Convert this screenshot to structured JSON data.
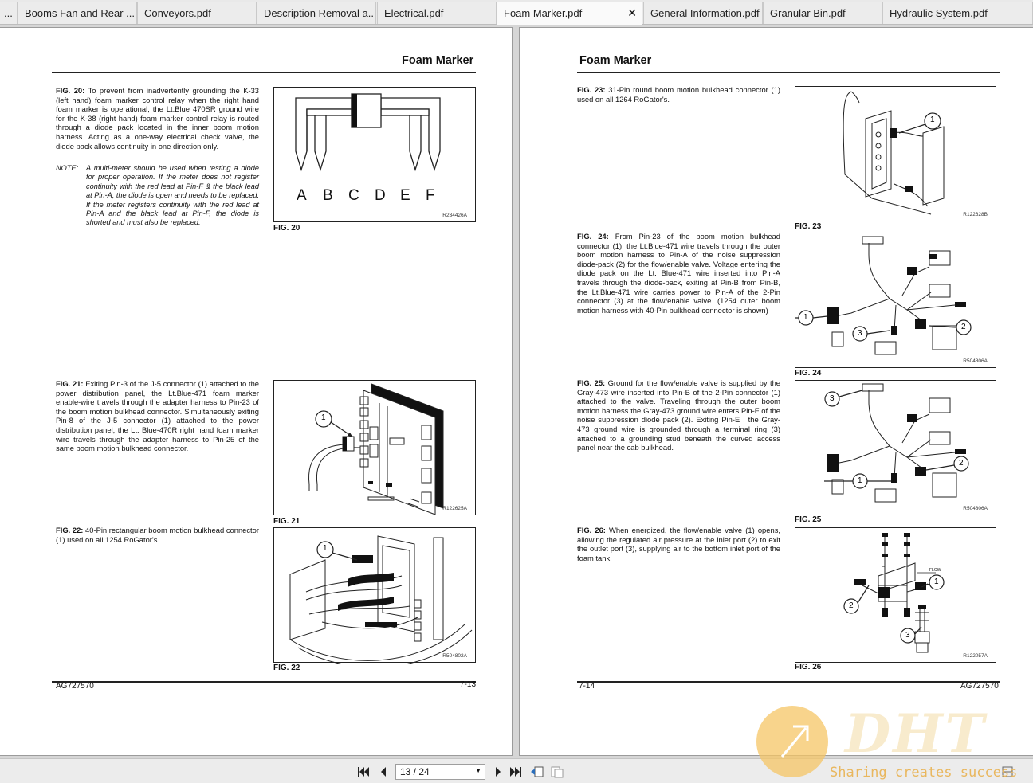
{
  "tabs": [
    {
      "label": "...",
      "active": false
    },
    {
      "label": "Booms Fan and Rear ...",
      "active": false
    },
    {
      "label": "Conveyors.pdf",
      "active": false
    },
    {
      "label": "Description Removal a...",
      "active": false
    },
    {
      "label": "Electrical.pdf",
      "active": false
    },
    {
      "label": "Foam Marker.pdf",
      "active": true,
      "close": "✕"
    },
    {
      "label": "General Information.pdf",
      "active": false
    },
    {
      "label": "Granular Bin.pdf",
      "active": false
    },
    {
      "label": "Hydraulic System.pdf",
      "active": false
    }
  ],
  "left_page": {
    "title": "Foam Marker",
    "fig20": {
      "label": "FIG. 20:",
      "text": "To prevent from inadvertently grounding the K-33 (left hand) foam marker control relay when the right hand foam marker is operational, the Lt.Blue 470SR ground wire for the K-38 (right hand) foam marker control relay is routed through a diode pack located in the inner boom motion harness. Acting as a one-way electrical check valve, the diode pack allows continuity in one direction only.",
      "note_label": "NOTE:",
      "note_text": "A multi-meter should be used when testing a diode for proper operation. If the meter does not register continuity with the red lead at Pin-F & the black lead at Pin-A, the diode is open and needs to be replaced. If the meter registers continuity with the red lead at Pin-A and the black lead at Pin-F, the diode is shorted and must also be replaced.",
      "caption": "FIG. 20",
      "code": "R234426A",
      "pins": [
        "A",
        "B",
        "C",
        "D",
        "E",
        "F"
      ]
    },
    "fig21": {
      "label": "FIG. 21:",
      "text": "Exiting Pin-3 of the J-5 connector (1) attached to the power distribution panel, the Lt.Blue-471 foam marker enable-wire travels through the adapter harness to Pin-23 of the boom motion bulkhead connector. Simultaneously exiting Pin-8 of the J-5 connector (1) attached to the power distribution panel, the Lt. Blue-470R right hand foam marker wire travels through the adapter harness to Pin-25 of the same boom motion bulkhead connector.",
      "caption": "FIG. 21",
      "code": "R122625A",
      "callout": "1"
    },
    "fig22": {
      "label": "FIG. 22:",
      "text": "40-Pin rectangular boom motion bulkhead connector (1) used on all 1254 RoGator's.",
      "caption": "FIG. 22",
      "code": "R504802A",
      "callout": "1"
    },
    "footer_left": "AG727570",
    "footer_right": "7-13"
  },
  "right_page": {
    "title": "Foam Marker",
    "fig23": {
      "label": "FIG. 23:",
      "text": "31-Pin round boom motion bulkhead connector (1) used on all 1264 RoGator's.",
      "caption": "FIG. 23",
      "code": "R122628B",
      "callout": "1"
    },
    "fig24": {
      "label": "FIG. 24:",
      "text": "From Pin-23 of the boom motion bulkhead connector (1), the Lt.Blue-471 wire travels through the outer boom motion harness to Pin-A of the noise suppression diode-pack (2) for the flow/enable valve. Voltage entering the diode pack on the Lt. Blue-471 wire inserted into Pin-A travels through the diode-pack, exiting at Pin-B from Pin-B, the Lt.Blue-471 wire carries power to Pin-A of the 2-Pin connector (3) at the flow/enable valve. (1254 outer boom motion harness with 40-Pin bulkhead connector is shown)",
      "caption": "FIG. 24",
      "code": "R504806A",
      "callouts": [
        "1",
        "2",
        "3"
      ]
    },
    "fig25": {
      "label": "FIG. 25:",
      "text": "Ground for the flow/enable valve is supplied by the Gray-473 wire inserted into Pin-B of the 2-Pin connector (1) attached to the valve. Traveling through the outer boom motion harness the Gray-473 ground wire enters Pin-F of the noise suppression diode pack (2). Exiting Pin-E , the Gray-473 ground wire is grounded through a terminal ring (3) attached to a grounding stud beneath the curved access panel near the cab bulkhead.",
      "caption": "FIG. 25",
      "code": "R504806A",
      "callouts": [
        "3",
        "2",
        "1"
      ]
    },
    "fig26": {
      "label": "FIG. 26:",
      "text": "When energized, the flow/enable valve (1) opens, allowing the regulated air pressure at the inlet port (2) to exit the outlet port (3), supplying air to the bottom inlet port of the foam tank.",
      "caption": "FIG. 26",
      "code": "R122057A",
      "callouts": [
        "1",
        "2",
        "3"
      ],
      "flow_label": "FLOW"
    },
    "footer_left": "7-14",
    "footer_right": "AG727570"
  },
  "toolbar": {
    "page_indicator": "13 / 24",
    "first_icon": "first-page-icon",
    "prev_icon": "previous-page-icon",
    "next_icon": "next-page-icon",
    "last_icon": "last-page-icon"
  },
  "watermark": {
    "logo_text": "DHT",
    "slogan": "Sharing creates success"
  }
}
